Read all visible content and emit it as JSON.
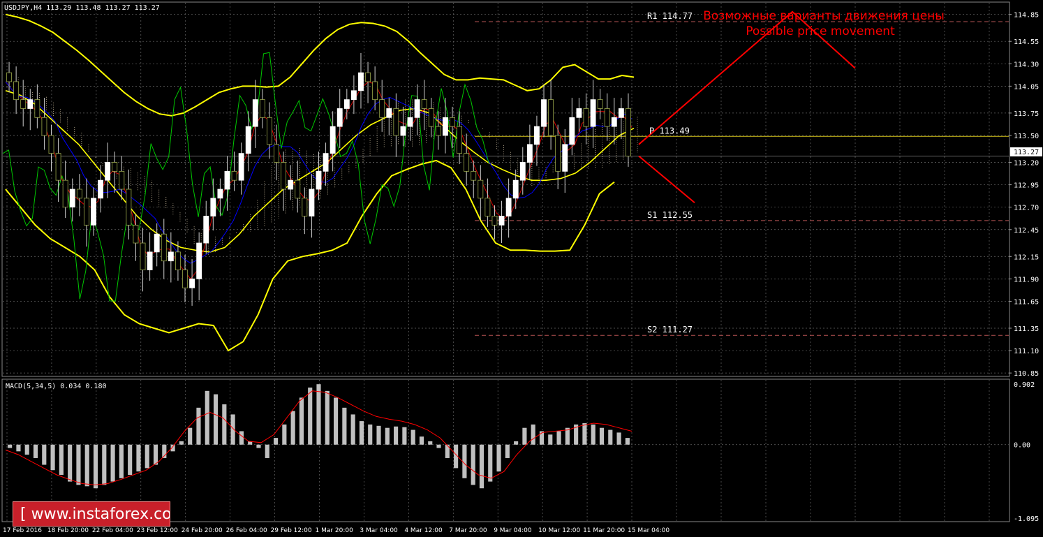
{
  "symbol_header": "USDJPY,H4  113.29 113.48 113.27 113.27",
  "macd_header": "MACD(5,34,5) 0.034 0.180",
  "watermark": "[ www.instaforex.com ]",
  "annotation": {
    "ru": "Возможные варианты движения цены",
    "en": "Possible price movement"
  },
  "levels": [
    {
      "name": "R1",
      "label": "R1 114.77",
      "value": 114.77,
      "color": "#b55353"
    },
    {
      "name": "P",
      "label": "P  113.49",
      "value": 113.49,
      "color": "#d4c21a"
    },
    {
      "name": "S1",
      "label": "S1 112.55",
      "value": 112.55,
      "color": "#b55353"
    },
    {
      "name": "S2",
      "label": "S2 111.27",
      "value": 111.27,
      "color": "#b55353"
    }
  ],
  "current_price": "113.27",
  "colors": {
    "background": "#000000",
    "grid": "#6a6a6a",
    "bollinger": "#ffff00",
    "bull_candle": "#ffffff",
    "bear_candle": "#6a7a2a",
    "kijun": "#0000ff",
    "tenkan": "#dd0000",
    "chikou": "#00c800",
    "macd_hist": "#c0c0c0",
    "macd_signal": "#ff0000",
    "annotation": "#ff0000",
    "price_label_bg": "#ffffff"
  },
  "chart_data": [
    {
      "type": "candlestick",
      "title": "USDJPY,H4",
      "y_ticks": [
        "114.85",
        "114.55",
        "114.30",
        "114.05",
        "113.75",
        "113.50",
        "113.20",
        "112.95",
        "112.70",
        "112.45",
        "112.15",
        "111.90",
        "111.65",
        "111.35",
        "111.10",
        "110.85"
      ],
      "ylim": [
        110.82,
        114.98
      ],
      "x_ticks": [
        "17 Feb 2016",
        "18 Feb 20:00",
        "22 Feb 04:00",
        "23 Feb 12:00",
        "24 Feb 20:00",
        "26 Feb 04:00",
        "29 Feb 12:00",
        "1 Mar 20:00",
        "3 Mar 04:00",
        "4 Mar 12:00",
        "7 Mar 20:00",
        "9 Mar 04:00",
        "10 Mar 12:00",
        "11 Mar 20:00",
        "15 Mar 04:00"
      ],
      "close": [
        114.1,
        113.9,
        113.8,
        113.9,
        113.7,
        113.5,
        113.3,
        113.0,
        112.7,
        112.9,
        112.8,
        112.5,
        112.8,
        113.0,
        113.2,
        113.1,
        112.9,
        112.5,
        112.3,
        112.0,
        112.2,
        112.4,
        112.1,
        112.2,
        112.0,
        111.8,
        111.9,
        112.3,
        112.6,
        112.8,
        112.9,
        113.1,
        113.0,
        113.3,
        113.6,
        113.9,
        113.7,
        113.4,
        113.2,
        112.9,
        113.0,
        112.8,
        112.6,
        112.9,
        113.1,
        113.3,
        113.6,
        113.8,
        113.9,
        114.0,
        114.2,
        114.1,
        113.9,
        113.7,
        113.8,
        113.5,
        113.6,
        113.7,
        113.9,
        113.8,
        113.6,
        113.5,
        113.7,
        113.6,
        113.3,
        113.1,
        113.0,
        112.8,
        112.6,
        112.5,
        112.6,
        112.8,
        113.0,
        113.2,
        113.4,
        113.6,
        113.9,
        113.5,
        113.1,
        113.4,
        113.7,
        113.8,
        113.6,
        113.9,
        113.8,
        113.6,
        113.7,
        113.8,
        113.27
      ],
      "bollinger_upper": [
        114.85,
        114.82,
        114.78,
        114.72,
        114.65,
        114.55,
        114.45,
        114.34,
        114.22,
        114.1,
        113.98,
        113.88,
        113.8,
        113.74,
        113.72,
        113.75,
        113.82,
        113.9,
        113.98,
        114.02,
        114.05,
        114.05,
        114.04,
        114.05,
        114.15,
        114.3,
        114.45,
        114.58,
        114.68,
        114.74,
        114.76,
        114.75,
        114.72,
        114.66,
        114.55,
        114.42,
        114.3,
        114.18,
        114.12,
        114.12,
        114.14,
        114.13,
        114.12,
        114.06,
        114.0,
        114.02,
        114.12,
        114.26,
        114.29,
        114.21,
        114.13,
        114.13,
        114.17,
        114.15
      ],
      "bollinger_mid": [
        114.0,
        113.95,
        113.85,
        113.7,
        113.55,
        113.4,
        113.2,
        113.0,
        112.8,
        112.6,
        112.45,
        112.33,
        112.25,
        112.22,
        112.2,
        112.25,
        112.4,
        112.6,
        112.75,
        112.9,
        113.0,
        113.1,
        113.2,
        113.35,
        113.5,
        113.62,
        113.7,
        113.78,
        113.8,
        113.75,
        113.6,
        113.45,
        113.32,
        113.2,
        113.12,
        113.05,
        113.0,
        113.0,
        113.02,
        113.08,
        113.2,
        113.35,
        113.5,
        113.58
      ],
      "bollinger_lower": [
        112.9,
        112.7,
        112.5,
        112.35,
        112.25,
        112.15,
        112.0,
        111.7,
        111.5,
        111.4,
        111.35,
        111.3,
        111.35,
        111.4,
        111.38,
        111.1,
        111.2,
        111.5,
        111.9,
        112.1,
        112.15,
        112.18,
        112.22,
        112.3,
        112.6,
        112.85,
        113.05,
        113.12,
        113.18,
        113.22,
        113.14,
        112.9,
        112.55,
        112.3,
        112.22,
        112.22,
        112.21,
        112.21,
        112.22,
        112.5,
        112.85,
        112.98
      ]
    },
    {
      "type": "bar",
      "title": "MACD(5,34,5)",
      "y_ticks": [
        "0.902",
        "0.00",
        "-1.095"
      ],
      "ylim": [
        -1.095,
        0.902
      ],
      "hist": [
        -0.05,
        -0.1,
        -0.15,
        -0.2,
        -0.3,
        -0.38,
        -0.45,
        -0.55,
        -0.6,
        -0.62,
        -0.65,
        -0.6,
        -0.55,
        -0.5,
        -0.45,
        -0.4,
        -0.35,
        -0.3,
        -0.2,
        -0.1,
        0.05,
        0.25,
        0.55,
        0.8,
        0.75,
        0.6,
        0.45,
        0.2,
        0.05,
        -0.05,
        -0.2,
        0.1,
        0.3,
        0.5,
        0.7,
        0.85,
        0.9,
        0.8,
        0.7,
        0.55,
        0.45,
        0.35,
        0.3,
        0.28,
        0.25,
        0.27,
        0.26,
        0.22,
        0.12,
        0.05,
        -0.05,
        -0.2,
        -0.35,
        -0.5,
        -0.6,
        -0.65,
        -0.55,
        -0.4,
        -0.2,
        0.05,
        0.25,
        0.3,
        0.2,
        0.15,
        0.2,
        0.25,
        0.3,
        0.32,
        0.3,
        0.25,
        0.22,
        0.18,
        0.1
      ],
      "signal": [
        -0.08,
        -0.15,
        -0.25,
        -0.35,
        -0.45,
        -0.52,
        -0.58,
        -0.6,
        -0.58,
        -0.52,
        -0.45,
        -0.38,
        -0.25,
        -0.05,
        0.2,
        0.4,
        0.48,
        0.4,
        0.2,
        0.05,
        0.03,
        0.15,
        0.4,
        0.65,
        0.8,
        0.78,
        0.7,
        0.6,
        0.5,
        0.42,
        0.38,
        0.35,
        0.3,
        0.22,
        0.1,
        -0.1,
        -0.3,
        -0.45,
        -0.5,
        -0.4,
        -0.15,
        0.05,
        0.18,
        0.2,
        0.22,
        0.28,
        0.32,
        0.3,
        0.25,
        0.2
      ]
    }
  ]
}
